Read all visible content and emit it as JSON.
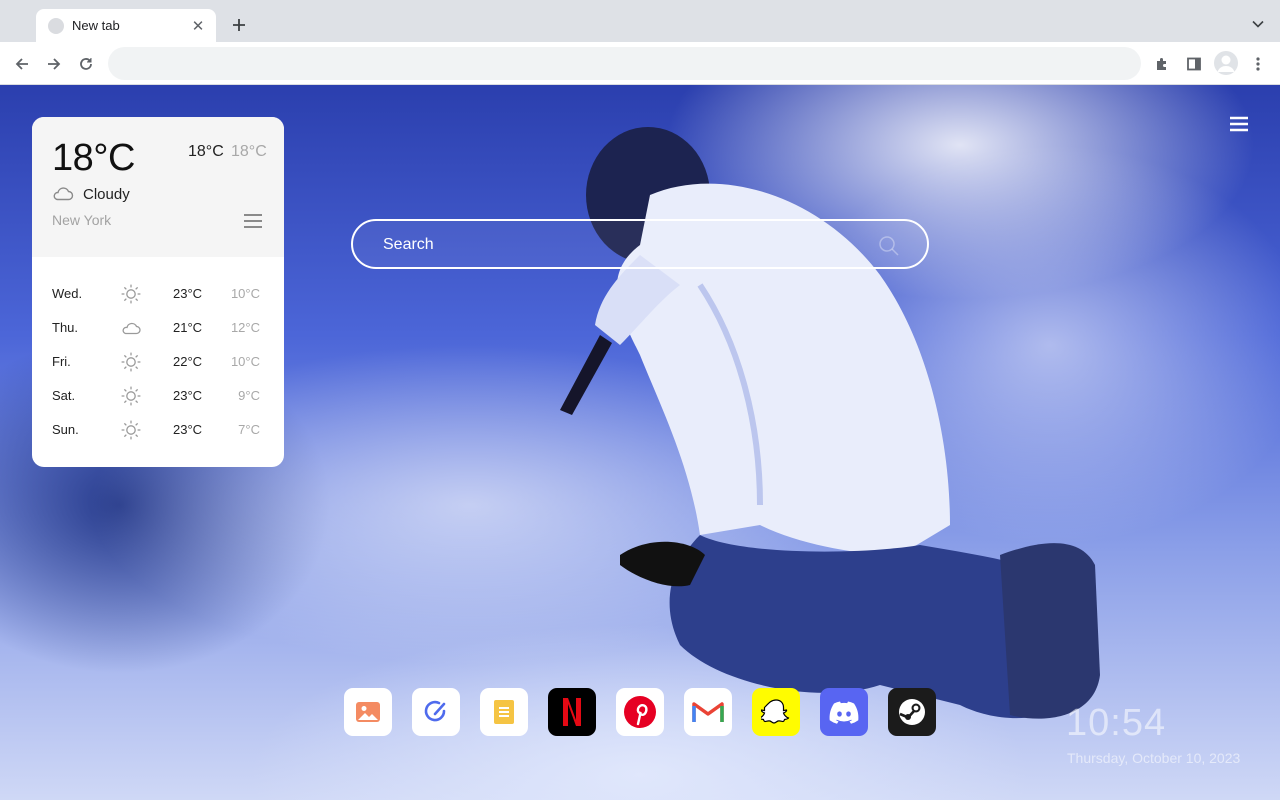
{
  "browser": {
    "tab_title": "New tab",
    "omnibox_value": ""
  },
  "weather": {
    "current_temp": "18°C",
    "high": "18°C",
    "low": "18°C",
    "condition": "Cloudy",
    "condition_icon": "cloud-icon",
    "city": "New York",
    "forecast": [
      {
        "day": "Wed.",
        "icon": "sun-icon",
        "high": "23°C",
        "low": "10°C"
      },
      {
        "day": "Thu.",
        "icon": "cloud-icon",
        "high": "21°C",
        "low": "12°C"
      },
      {
        "day": "Fri.",
        "icon": "sun-icon",
        "high": "22°C",
        "low": "10°C"
      },
      {
        "day": "Sat.",
        "icon": "sun-icon",
        "high": "23°C",
        "low": "9°C"
      },
      {
        "day": "Sun.",
        "icon": "sun-icon",
        "high": "23°C",
        "low": "7°C"
      }
    ]
  },
  "search": {
    "placeholder": "Search"
  },
  "dock": {
    "apps": [
      {
        "name": "photos",
        "icon": "image-icon",
        "color": "#ffffff"
      },
      {
        "name": "tasks",
        "icon": "pen-icon",
        "color": "#ffffff"
      },
      {
        "name": "notes",
        "icon": "note-icon",
        "color": "#ffffff"
      },
      {
        "name": "netflix",
        "icon": "netflix-icon",
        "color": "#000000"
      },
      {
        "name": "pinterest",
        "icon": "pinterest-icon",
        "color": "#ffffff"
      },
      {
        "name": "gmail",
        "icon": "gmail-icon",
        "color": "#ffffff"
      },
      {
        "name": "snapchat",
        "icon": "snapchat-icon",
        "color": "#fffc00"
      },
      {
        "name": "discord",
        "icon": "discord-icon",
        "color": "#5865f2"
      },
      {
        "name": "steam",
        "icon": "steam-icon",
        "color": "#1b1b1b"
      }
    ]
  },
  "clock": {
    "time": "10:54",
    "date": "Thursday, October 10, 2023"
  }
}
